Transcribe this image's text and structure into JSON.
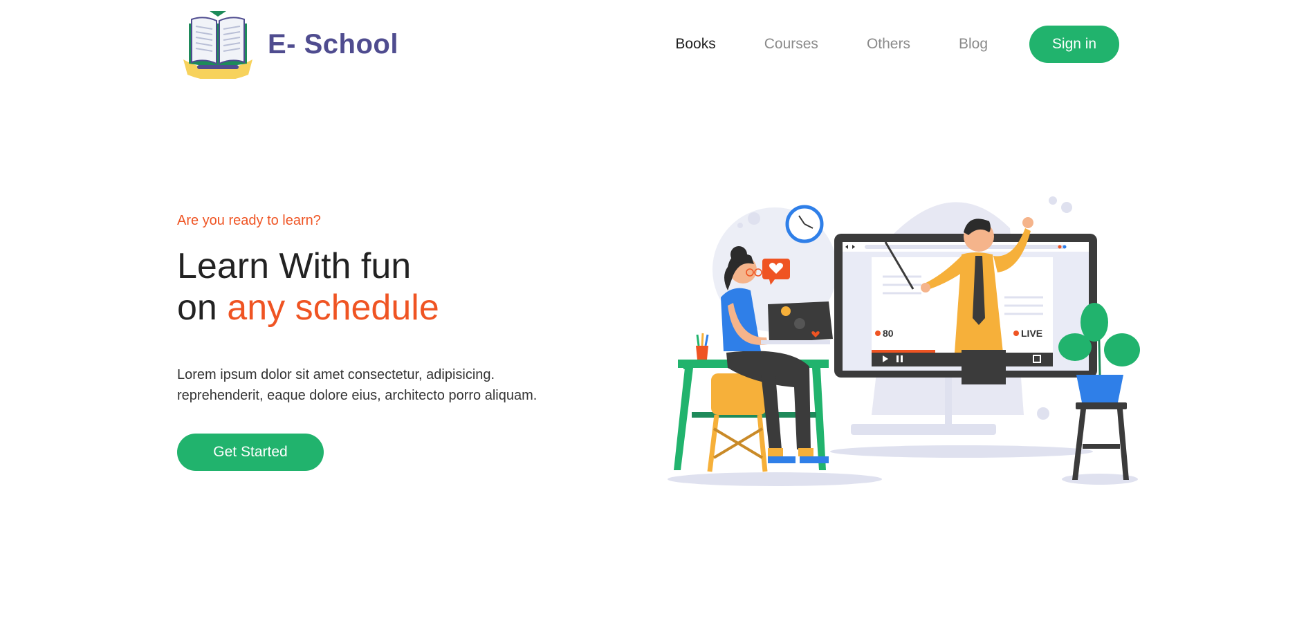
{
  "brand": {
    "name": "E- School",
    "logo_icon": "open-book-icon"
  },
  "nav": {
    "items": [
      {
        "label": "Books",
        "active": true
      },
      {
        "label": "Courses",
        "active": false
      },
      {
        "label": "Others",
        "active": false
      },
      {
        "label": "Blog",
        "active": false
      }
    ],
    "signin_label": "Sign in"
  },
  "hero": {
    "eyebrow": "Are you ready to learn?",
    "headline_line1": "Learn With fun",
    "headline_line2_prefix": "on ",
    "headline_line2_accent": "any schedule",
    "description_line1": "Lorem ipsum dolor sit amet consectetur, adipisicing.",
    "description_line2": "reprehenderit, eaque dolore eius, architecto porro aliquam.",
    "cta_label": "Get Started"
  },
  "illustration": {
    "viewer_count": "80",
    "live_label": "LIVE"
  },
  "colors": {
    "brand": "#4f4c8f",
    "primary": "#21b36d",
    "accent": "#ef5423"
  }
}
